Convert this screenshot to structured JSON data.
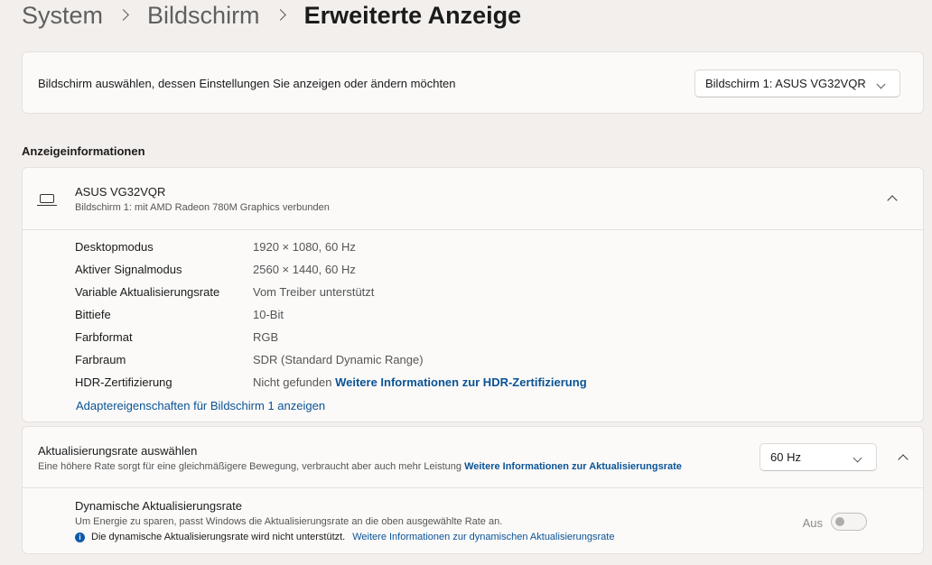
{
  "breadcrumb": {
    "items": [
      "System",
      "Bildschirm"
    ],
    "current": "Erweiterte Anzeige"
  },
  "select_display": {
    "label": "Bildschirm auswählen, dessen Einstellungen Sie anzeigen oder ändern möchten",
    "selected": "Bildschirm 1: ASUS VG32VQR"
  },
  "display_info": {
    "heading": "Anzeigeinformationen",
    "device_name": "ASUS VG32VQR",
    "device_subtitle": "Bildschirm 1: mit AMD Radeon 780M Graphics verbunden",
    "rows": [
      {
        "label": "Desktopmodus",
        "value": "1920 × 1080, 60 Hz"
      },
      {
        "label": "Aktiver Signalmodus",
        "value": "2560 × 1440, 60 Hz"
      },
      {
        "label": "Variable Aktualisierungsrate",
        "value": "Vom Treiber unterstützt"
      },
      {
        "label": "Bittiefe",
        "value": "10-Bit"
      },
      {
        "label": "Farbformat",
        "value": "RGB"
      },
      {
        "label": "Farbraum",
        "value": "SDR (Standard Dynamic Range)"
      },
      {
        "label": "HDR-Zertifizierung",
        "value": "Nicht gefunden",
        "link": "Weitere Informationen zur HDR-Zertifizierung"
      }
    ],
    "adapter_link": "Adaptereigenschaften für Bildschirm 1 anzeigen"
  },
  "refresh_rate": {
    "title": "Aktualisierungsrate auswählen",
    "subtitle": "Eine höhere Rate sorgt für eine gleichmäßigere Bewegung, verbraucht aber auch mehr Leistung",
    "subtitle_link": "Weitere Informationen zur Aktualisierungsrate",
    "selected": "60 Hz",
    "dynamic": {
      "title": "Dynamische Aktualisierungsrate",
      "subtitle": "Um Energie zu sparen, passt Windows die Aktualisierungsrate an die oben ausgewählte Rate an.",
      "note": "Die dynamische Aktualisierungsrate wird nicht unterstützt.",
      "note_link": "Weitere Informationen zur dynamischen Aktualisierungsrate",
      "toggle_label": "Aus",
      "toggle_on": false
    }
  },
  "colors": {
    "accent": "#0b5394",
    "background": "#f3efec",
    "card": "#fbfaf9"
  },
  "icons": {
    "monitor": "laptop-icon",
    "info": "info-icon",
    "chevron": "chevron-down-icon",
    "collapse": "chevron-up-icon"
  }
}
